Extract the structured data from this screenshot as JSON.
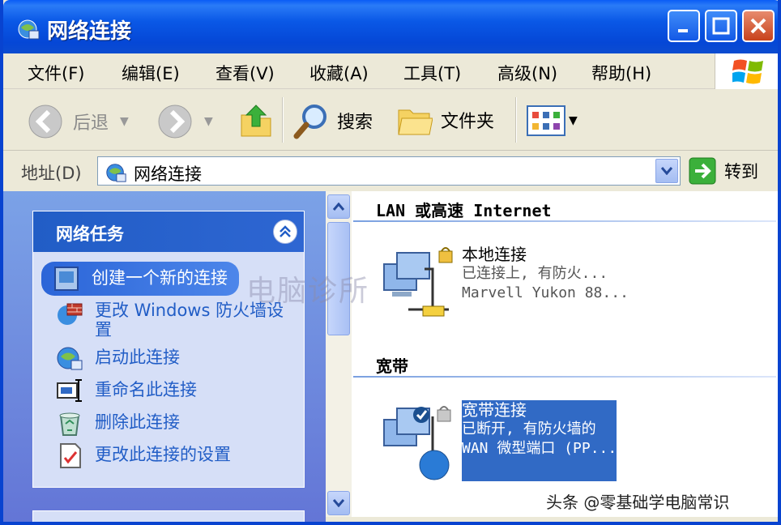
{
  "window": {
    "title": "网络连接"
  },
  "menubar": {
    "items": [
      "文件(F)",
      "编辑(E)",
      "查看(V)",
      "收藏(A)",
      "工具(T)",
      "高级(N)",
      "帮助(H)"
    ]
  },
  "toolbar": {
    "back": "后退",
    "search": "搜索",
    "folders": "文件夹"
  },
  "address": {
    "label": "地址(D)",
    "value": "网络连接",
    "go": "转到"
  },
  "taskpane": {
    "title": "网络任务",
    "items": [
      "创建一个新的连接",
      "更改 Windows 防火墙设置",
      "启动此连接",
      "重命名此连接",
      "删除此连接",
      "更改此连接的设置"
    ]
  },
  "groups": [
    {
      "title": "LAN 或高速 Internet",
      "connection": {
        "name": "本地连接",
        "status": "已连接上, 有防火...",
        "device": "Marvell Yukon 88..."
      }
    },
    {
      "title": "宽带",
      "connection": {
        "name": "宽带连接",
        "status": "已断开, 有防火墙的",
        "device": "WAN 微型端口 (PP..."
      }
    }
  ],
  "watermarks": {
    "center": "电脑诊所",
    "corner": "头条 @零基础学电脑常识"
  },
  "colors": {
    "title_bar": "#0a58e6",
    "task_pane": "#6375d6",
    "selection": "#316ac5"
  }
}
